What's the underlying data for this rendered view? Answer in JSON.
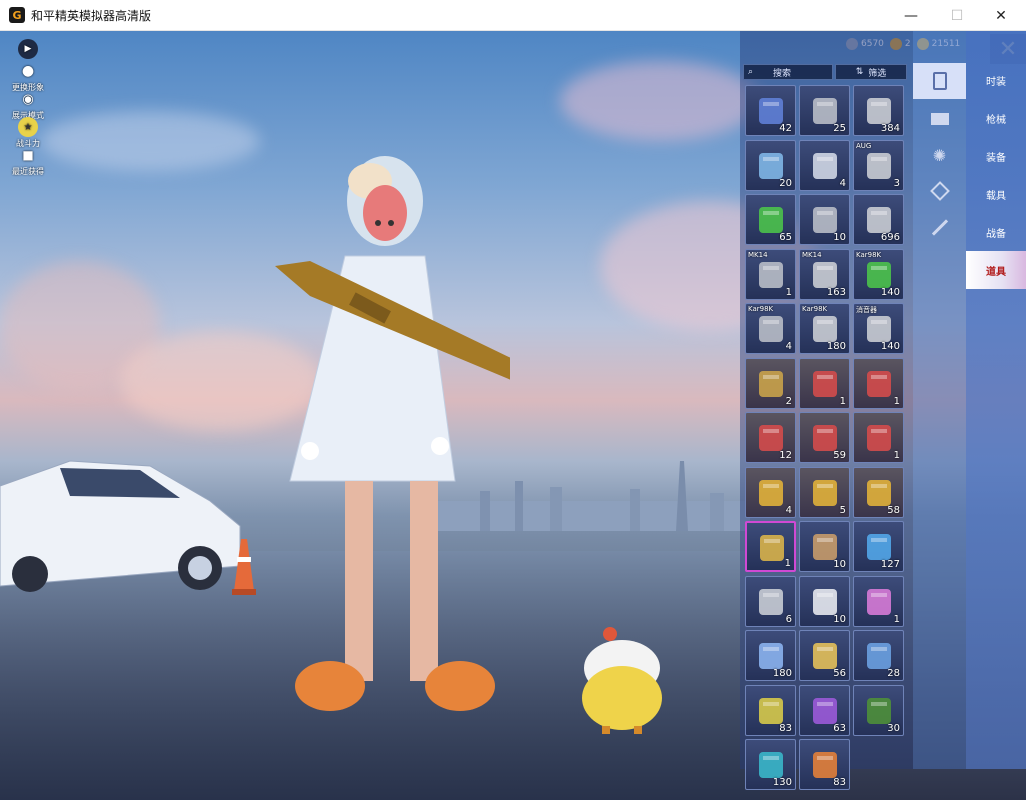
{
  "window": {
    "title": "和平精英模拟器高清版",
    "app_icon_glyph": "G",
    "min_glyph": "—",
    "max_glyph": "☐",
    "close_glyph": "✕"
  },
  "hud_left": [
    {
      "id": "play",
      "label": "",
      "icon": "play-icon",
      "color": "#1e2a44"
    },
    {
      "id": "change",
      "label": "更换形象",
      "icon": "person-icon",
      "color": "#ffffff"
    },
    {
      "id": "show",
      "label": "展示模式",
      "icon": "eye-icon",
      "color": "#ffffff"
    },
    {
      "id": "rank",
      "label": "战斗力",
      "icon": "rank-badge-icon",
      "color": "#e8d24a"
    },
    {
      "id": "recent",
      "label": "最近获得",
      "icon": "gift-icon",
      "color": "#ffffff"
    }
  ],
  "currency": [
    {
      "icon": "coin-icon",
      "value": "6570",
      "color": "#9aa6c2"
    },
    {
      "icon": "medal-icon",
      "value": "2",
      "color": "#d9a23c"
    },
    {
      "icon": "gem-icon",
      "value": "21511",
      "color": "#e9c86a"
    }
  ],
  "back_glyph": "✕",
  "search": {
    "label": "搜索",
    "filter_label": "筛选",
    "search_glyph": "⌕",
    "filter_glyph": "⇅"
  },
  "nav": {
    "items": [
      "时装",
      "枪械",
      "装备",
      "载具",
      "战备"
    ],
    "active_label": "道具"
  },
  "subtabs": [
    "card-icon",
    "box-icon",
    "firework-icon",
    "ticket-icon",
    "gun-icon"
  ],
  "slots": [
    {
      "icon": "spray-can-icon",
      "count": "42",
      "tag": ""
    },
    {
      "icon": "weapon-case-icon",
      "count": "25",
      "tag": ""
    },
    {
      "icon": "spring-icon",
      "count": "384",
      "tag": ""
    },
    {
      "icon": "grip-icon",
      "count": "20",
      "tag": ""
    },
    {
      "icon": "scope-part-icon",
      "count": "4",
      "tag": ""
    },
    {
      "icon": "spring-icon",
      "count": "3",
      "tag": "AUG"
    },
    {
      "icon": "green-spray-icon",
      "count": "65",
      "tag": ""
    },
    {
      "icon": "weapon-case-icon",
      "count": "10",
      "tag": ""
    },
    {
      "icon": "spring-icon",
      "count": "696",
      "tag": ""
    },
    {
      "icon": "weapon-case-icon",
      "count": "1",
      "tag": "MK14"
    },
    {
      "icon": "spring-icon",
      "count": "163",
      "tag": "MK14"
    },
    {
      "icon": "green-spray-icon",
      "count": "140",
      "tag": "Kar98K"
    },
    {
      "icon": "weapon-case-icon",
      "count": "4",
      "tag": "Kar98K"
    },
    {
      "icon": "spring-icon",
      "count": "180",
      "tag": "Kar98K"
    },
    {
      "icon": "spring-icon",
      "count": "140",
      "tag": "消音器"
    },
    {
      "icon": "id-card-icon",
      "count": "2",
      "tag": ""
    },
    {
      "icon": "ticket-red-icon",
      "count": "1",
      "tag": ""
    },
    {
      "icon": "ticket-red-icon",
      "count": "1",
      "tag": ""
    },
    {
      "icon": "ticket-red-icon",
      "count": "12",
      "tag": ""
    },
    {
      "icon": "ticket-red-icon",
      "count": "59",
      "tag": ""
    },
    {
      "icon": "ticket-red-icon",
      "count": "1",
      "tag": ""
    },
    {
      "icon": "ticket-gold-icon",
      "count": "4",
      "tag": ""
    },
    {
      "icon": "ticket-gold-icon",
      "count": "5",
      "tag": ""
    },
    {
      "icon": "ticket-gold-icon",
      "count": "58",
      "tag": ""
    },
    {
      "icon": "lion-emblem-icon",
      "count": "1",
      "tag": ""
    },
    {
      "icon": "bat-icon",
      "count": "10",
      "tag": ""
    },
    {
      "icon": "orb-icon",
      "count": "127",
      "tag": ""
    },
    {
      "icon": "ring-icon",
      "count": "6",
      "tag": ""
    },
    {
      "icon": "key-icon",
      "count": "10",
      "tag": ""
    },
    {
      "icon": "hex-gem-icon",
      "count": "1",
      "tag": ""
    },
    {
      "icon": "diamond-card-icon",
      "count": "180",
      "tag": ""
    },
    {
      "icon": "gold-card-icon",
      "count": "56",
      "tag": ""
    },
    {
      "icon": "blue-card-icon",
      "count": "28",
      "tag": ""
    },
    {
      "icon": "smoke-grenade-icon",
      "count": "83",
      "tag": ""
    },
    {
      "icon": "paint-can-icon",
      "count": "63",
      "tag": ""
    },
    {
      "icon": "green-box-icon",
      "count": "30",
      "tag": ""
    },
    {
      "icon": "spray-gun-icon",
      "count": "130",
      "tag": ""
    },
    {
      "icon": "badge-icon",
      "count": "83",
      "tag": ""
    }
  ],
  "colors": {
    "accent": "#d049d4",
    "nav_active_text": "#b11a1a",
    "panel": "#253158"
  }
}
